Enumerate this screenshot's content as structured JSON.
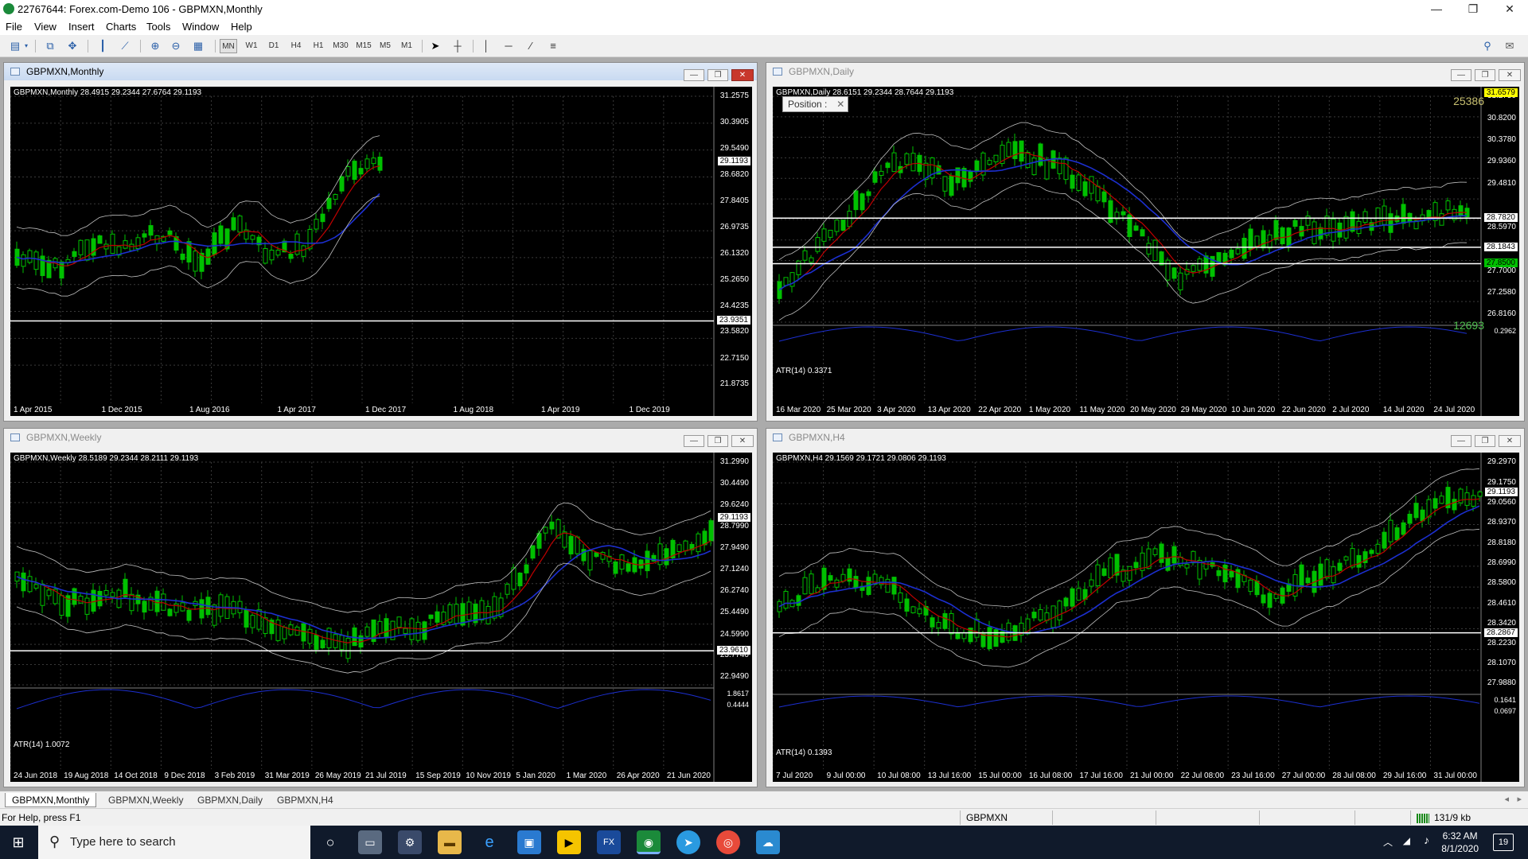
{
  "app": {
    "title": "22767644: Forex.com-Demo 106 - GBPMXN,Monthly"
  },
  "window_controls": {
    "minimize": "—",
    "restore": "❐",
    "close": "✕"
  },
  "menu": [
    "File",
    "View",
    "Insert",
    "Charts",
    "Tools",
    "Window",
    "Help"
  ],
  "toolbar": {
    "timeframes": [
      "MN",
      "W1",
      "D1",
      "H4",
      "H1",
      "M30",
      "M15",
      "M5",
      "M1"
    ]
  },
  "charts": [
    {
      "window_title": "GBPMXN,Monthly",
      "active": true,
      "symbol_line": "GBPMXN,Monthly  28.4915 29.2344 27.6764 29.1193",
      "price_axis": [
        "31.2575",
        "30.3905",
        "29.5490",
        "28.6820",
        "27.8405",
        "26.9735",
        "26.1320",
        "25.2650",
        "24.4235",
        "23.5820",
        "22.7150",
        "21.8735"
      ],
      "price_boxes": [
        {
          "label": "29.1193",
          "value": 29.1193
        },
        {
          "label": "23.9351",
          "value": 23.9351
        }
      ],
      "dates": [
        "1 Apr 2015",
        "1 Dec 2015",
        "1 Aug 2016",
        "1 Apr 2017",
        "1 Dec 2017",
        "1 Aug 2018",
        "1 Apr 2019",
        "1 Dec 2019"
      ],
      "atr_label": ""
    },
    {
      "window_title": "GBPMXN,Daily",
      "active": false,
      "symbol_line": "GBPMXN,Daily  28.6151 29.2344 28.7644 29.1193",
      "position_popup": "Position :",
      "counter_top": "25386",
      "counter_bottom": "12693",
      "price_axis": [
        "31.2750",
        "30.8200",
        "30.3780",
        "29.9360",
        "29.4810",
        "28.5970",
        "27.7000",
        "27.2580",
        "26.8160"
      ],
      "price_boxes": [
        {
          "label": "31.6579",
          "value": 31.6579,
          "color": "#ffff00"
        },
        {
          "label": "28.7820",
          "value": 28.782,
          "color": "#ffffff"
        },
        {
          "label": "28.1843",
          "value": 28.1843,
          "color": "#ffffff"
        },
        {
          "label": "27.8500",
          "value": 27.85,
          "color": "#00c000"
        }
      ],
      "dates": [
        "16 Mar 2020",
        "25 Mar 2020",
        "3 Apr 2020",
        "13 Apr 2020",
        "22 Apr 2020",
        "1 May 2020",
        "11 May 2020",
        "20 May 2020",
        "29 May 2020",
        "10 Jun 2020",
        "22 Jun 2020",
        "2 Jul 2020",
        "14 Jul 2020",
        "24 Jul 2020"
      ],
      "atr_label": "ATR(14) 0.3371",
      "atr_axis": [
        "0.2962"
      ]
    },
    {
      "window_title": "GBPMXN,Weekly",
      "active": false,
      "symbol_line": "GBPMXN,Weekly  28.5189 29.2344 28.2111 29.1193",
      "price_axis": [
        "31.2990",
        "30.4490",
        "29.6240",
        "28.7990",
        "27.9490",
        "27.1240",
        "26.2740",
        "25.4490",
        "24.5990",
        "23.7740",
        "22.9490"
      ],
      "price_boxes": [
        {
          "label": "29.1193",
          "value": 29.1193
        },
        {
          "label": "23.9610",
          "value": 23.961
        }
      ],
      "dates": [
        "24 Jun 2018",
        "19 Aug 2018",
        "14 Oct 2018",
        "9 Dec 2018",
        "3 Feb 2019",
        "31 Mar 2019",
        "26 May 2019",
        "21 Jul 2019",
        "15 Sep 2019",
        "10 Nov 2019",
        "5 Jan 2020",
        "1 Mar 2020",
        "26 Apr 2020",
        "21 Jun 2020"
      ],
      "atr_label": "ATR(14) 1.0072",
      "atr_axis": [
        "1.8617",
        "0.4444"
      ]
    },
    {
      "window_title": "GBPMXN,H4",
      "active": false,
      "symbol_line": "GBPMXN,H4  29.1569 29.1721 29.0806 29.1193",
      "price_axis": [
        "29.2970",
        "29.1750",
        "29.0560",
        "28.9370",
        "28.8180",
        "28.6990",
        "28.5800",
        "28.4610",
        "28.3420",
        "28.2230",
        "28.1070",
        "27.9880"
      ],
      "price_boxes": [
        {
          "label": "29.1193",
          "value": 29.1193
        },
        {
          "label": "28.2867",
          "value": 28.2867
        }
      ],
      "dates": [
        "7 Jul 2020",
        "9 Jul 00:00",
        "10 Jul 08:00",
        "13 Jul 16:00",
        "15 Jul 00:00",
        "16 Jul 08:00",
        "17 Jul 16:00",
        "21 Jul 00:00",
        "22 Jul 08:00",
        "23 Jul 16:00",
        "27 Jul 00:00",
        "28 Jul 08:00",
        "29 Jul 16:00",
        "31 Jul 00:00"
      ],
      "atr_label": "ATR(14) 0.1393",
      "atr_axis": [
        "0.1641",
        "0.0697"
      ]
    }
  ],
  "tabs": [
    "GBPMXN,Monthly",
    "GBPMXN,Weekly",
    "GBPMXN,Daily",
    "GBPMXN,H4"
  ],
  "status": {
    "help": "For Help, press F1",
    "symbol": "GBPMXN",
    "traffic": "131/9 kb"
  },
  "taskbar": {
    "search_placeholder": "Type here to search",
    "time": "6:32 AM",
    "date": "8/1/2020",
    "notifications": "19"
  },
  "colors": {
    "chart_bg": "#000000",
    "candle": "#00c000",
    "grid": "#3a3a3a",
    "ma_red": "#c00000",
    "ma_blue": "#1c2fd0",
    "bands": "#c0c0c0"
  }
}
